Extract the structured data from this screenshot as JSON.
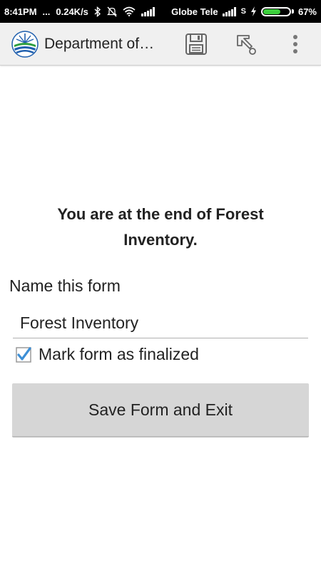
{
  "status_bar": {
    "time": "8:41PM",
    "dots": "...",
    "network_speed": "0.24K/s",
    "carrier": "Globe Tele",
    "sim2_label": "S",
    "battery_percent": "67%",
    "battery_level": 0.67,
    "icons": [
      "bluetooth-icon",
      "mute-icon",
      "wifi-icon",
      "signal-icon",
      "signal-icon-2",
      "charging-icon",
      "battery-icon"
    ]
  },
  "app_bar": {
    "title": "Department of…",
    "logo": "denr-logo",
    "actions": [
      "save-icon",
      "goto-icon",
      "overflow-menu-icon"
    ]
  },
  "form_end": {
    "message": "You are at the end of Forest Inventory.",
    "name_label": "Name this form",
    "name_value": "Forest Inventory",
    "finalize_checked": true,
    "finalize_label": "Mark form as finalized",
    "save_button_label": "Save Form and Exit"
  },
  "colors": {
    "checkbox_accent": "#3d8fd6",
    "battery_fill": "#3ccf3c",
    "app_bar_bg": "#f0f0f0",
    "button_bg": "#d6d6d6"
  }
}
